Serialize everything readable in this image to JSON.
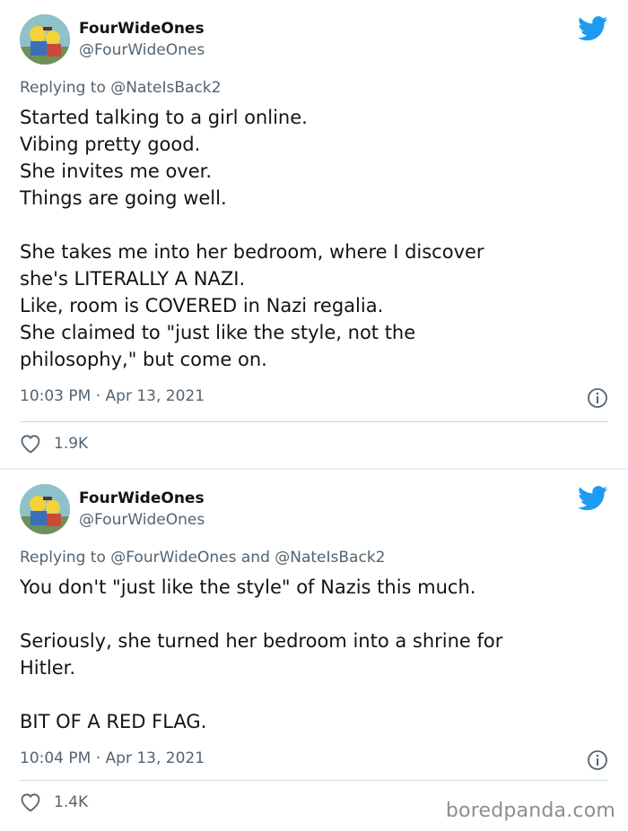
{
  "tweets": [
    {
      "author_name": "FourWideOnes",
      "author_handle": "@FourWideOnes",
      "reply_prefix": "Replying to ",
      "reply_mentions": "@NateIsBack2",
      "lines": [
        "Started talking to a girl online.",
        "Vibing pretty good.",
        "She invites me over.",
        "Things are going well.",
        "",
        "She takes me into her bedroom, where I discover",
        "she's LITERALLY A NAZI.",
        "Like, room is COVERED in Nazi regalia.",
        "She claimed to \"just like the style, not the",
        "philosophy,\" but come on."
      ],
      "timestamp": "10:03 PM · Apr 13, 2021",
      "likes": "1.9K"
    },
    {
      "author_name": "FourWideOnes",
      "author_handle": "@FourWideOnes",
      "reply_prefix": "Replying to ",
      "reply_mentions": "@FourWideOnes and @NateIsBack2",
      "lines": [
        "You don't \"just like the style\" of Nazis this much.",
        "",
        "Seriously, she turned her bedroom into a shrine for",
        "Hitler.",
        "",
        "BIT OF A RED FLAG."
      ],
      "timestamp": "10:04 PM · Apr 13, 2021",
      "likes": "1.4K"
    }
  ],
  "icons": {
    "brand": "twitter-bird-icon",
    "info": "info-icon",
    "like": "heart-icon"
  },
  "colors": {
    "twitter_blue": "#1d9bf0",
    "secondary_text": "#536471",
    "primary_text": "#0f1419"
  },
  "watermark": "boredpanda.com"
}
